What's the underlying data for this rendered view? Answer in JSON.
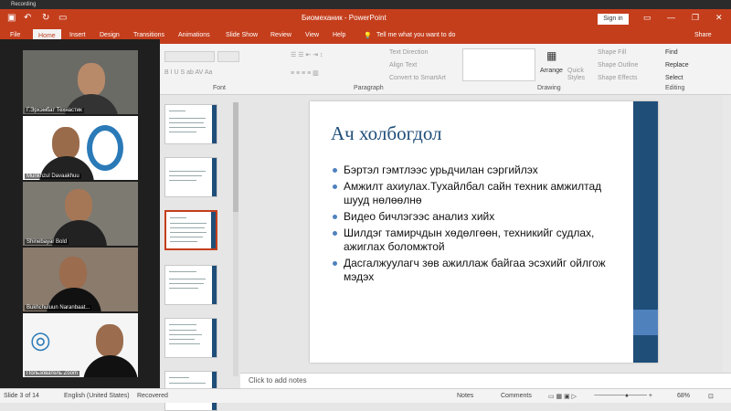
{
  "recording": "Recording",
  "title": "Биомеханик  -  PowerPoint",
  "signin": "Sign in",
  "share": "Share",
  "tell_me": "Tell me what you want to do",
  "tabs": [
    "File",
    "Home",
    "Insert",
    "Design",
    "Transitions",
    "Animations",
    "Slide Show",
    "Review",
    "View",
    "Help"
  ],
  "ribbon": {
    "font_group": "Font",
    "paragraph_group": "Paragraph",
    "drawing_group": "Drawing",
    "editing_group": "Editing",
    "text_direction": "Text Direction",
    "align_text": "Align Text",
    "convert_smartart": "Convert to SmartArt",
    "arrange": "Arrange",
    "quick_styles": "Quick Styles",
    "shape_fill": "Shape Fill",
    "shape_outline": "Shape Outline",
    "shape_effects": "Shape Effects",
    "find": "Find",
    "replace": "Replace",
    "select": "Select"
  },
  "participants": [
    {
      "name": "Г.Эрхэмбат Технастик"
    },
    {
      "name": "Munkhzul Davaakhuu"
    },
    {
      "name": "Shinebayar Bold"
    },
    {
      "name": "Bukhchuluun Naranbaat..."
    },
    {
      "name": "Пользователь Zoom"
    }
  ],
  "slide": {
    "title": "Ач холбогдол",
    "bullets": [
      "Бэртэл гэмтлээс урьдчилан сэргийлэх",
      "Амжилт ахиулах.Тухайлбал сайн техник амжилтад шууд нөлөөлнө",
      "Видео бичлэгээс анализ хийх",
      "Шилдэг тамирчдын хөдөлгөөн, техникийг судлах, ажиглах боломжтой",
      "Дасгалжуулагч зөв ажиллаж байгаа эсэхийг ойлгож мэдэх"
    ]
  },
  "thumb_numbers": [
    "2",
    "3",
    "4",
    "5",
    "6",
    "7"
  ],
  "notes_placeholder": "Click to add notes",
  "status": {
    "slide_info": "Slide 3 of 14",
    "language": "English (United States)",
    "recovered": "Recovered",
    "notes": "Notes",
    "comments": "Comments",
    "zoom": "68%"
  }
}
